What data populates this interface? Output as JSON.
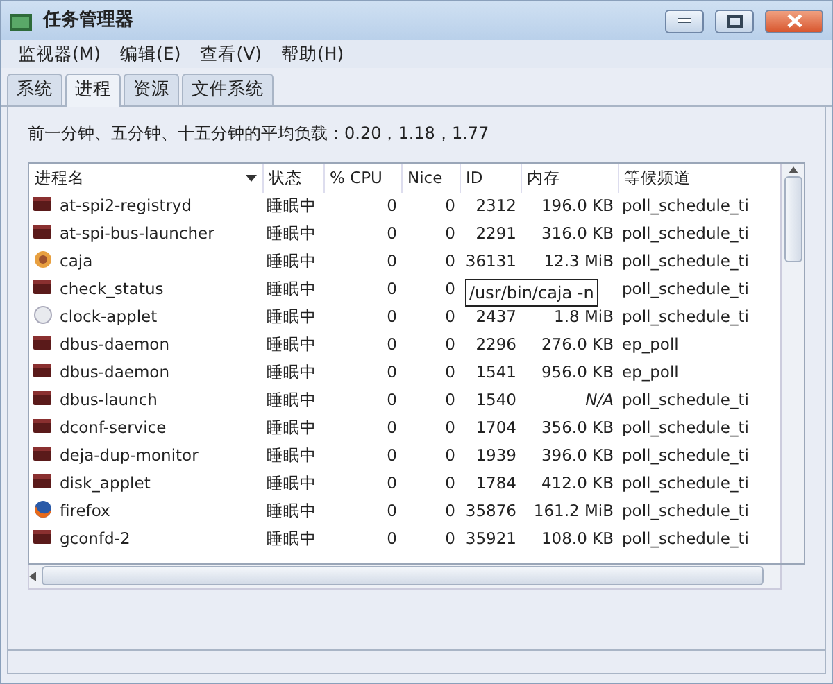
{
  "window": {
    "title": "任务管理器"
  },
  "menu": [
    "监视器(M)",
    "编辑(E)",
    "查看(V)",
    "帮助(H)"
  ],
  "tabs": [
    {
      "label": "系统",
      "selected": false
    },
    {
      "label": "进程",
      "selected": true
    },
    {
      "label": "资源",
      "selected": false
    },
    {
      "label": "文件系统",
      "selected": false
    }
  ],
  "load_text": "前一分钟、五分钟、十五分钟的平均负载：0.20，1.18，1.77",
  "table": {
    "columns": [
      "进程名",
      "状态",
      "% CPU",
      "Nice",
      "ID",
      "内存",
      "等候频道"
    ],
    "rows": [
      {
        "kind": "app",
        "name": "at-spi2-registryd",
        "status": "睡眠中",
        "cpu": "0",
        "nice": "0",
        "id": "2312",
        "memory": "196.0 KB",
        "wait": "poll_schedule_ti"
      },
      {
        "kind": "app",
        "name": "at-spi-bus-launcher",
        "status": "睡眠中",
        "cpu": "0",
        "nice": "0",
        "id": "2291",
        "memory": "316.0 KB",
        "wait": "poll_schedule_ti"
      },
      {
        "kind": "caja",
        "name": "caja",
        "status": "睡眠中",
        "cpu": "0",
        "nice": "0",
        "id": "36131",
        "memory": "12.3 MiB",
        "wait": "poll_schedule_ti"
      },
      {
        "kind": "app",
        "name": "check_status",
        "status": "睡眠中",
        "cpu": "0",
        "nice": "0",
        "tooltip": "/usr/bin/caja -n",
        "wait": "poll_schedule_ti"
      },
      {
        "kind": "clock",
        "name": "clock-applet",
        "status": "睡眠中",
        "cpu": "0",
        "nice": "0",
        "id": "2437",
        "memory": "1.8 MiB",
        "wait": "poll_schedule_ti"
      },
      {
        "kind": "app",
        "name": "dbus-daemon",
        "status": "睡眠中",
        "cpu": "0",
        "nice": "0",
        "id": "2296",
        "memory": "276.0 KB",
        "wait": "ep_poll"
      },
      {
        "kind": "app",
        "name": "dbus-daemon",
        "status": "睡眠中",
        "cpu": "0",
        "nice": "0",
        "id": "1541",
        "memory": "956.0 KB",
        "wait": "ep_poll"
      },
      {
        "kind": "app",
        "name": "dbus-launch",
        "status": "睡眠中",
        "cpu": "0",
        "nice": "0",
        "id": "1540",
        "memory": "N/A",
        "wait": "poll_schedule_ti"
      },
      {
        "kind": "app",
        "name": "dconf-service",
        "status": "睡眠中",
        "cpu": "0",
        "nice": "0",
        "id": "1704",
        "memory": "356.0 KB",
        "wait": "poll_schedule_ti"
      },
      {
        "kind": "app",
        "name": "deja-dup-monitor",
        "status": "睡眠中",
        "cpu": "0",
        "nice": "0",
        "id": "1939",
        "memory": "396.0 KB",
        "wait": "poll_schedule_ti"
      },
      {
        "kind": "app",
        "name": "disk_applet",
        "status": "睡眠中",
        "cpu": "0",
        "nice": "0",
        "id": "1784",
        "memory": "412.0 KB",
        "wait": "poll_schedule_ti"
      },
      {
        "kind": "firefox",
        "name": "firefox",
        "status": "睡眠中",
        "cpu": "0",
        "nice": "0",
        "id": "35876",
        "memory": "161.2 MiB",
        "wait": "poll_schedule_ti"
      },
      {
        "kind": "app",
        "name": "gconfd-2",
        "status": "睡眠中",
        "cpu": "0",
        "nice": "0",
        "id": "35921",
        "memory": "108.0 KB",
        "wait": "poll_schedule_ti"
      }
    ]
  }
}
